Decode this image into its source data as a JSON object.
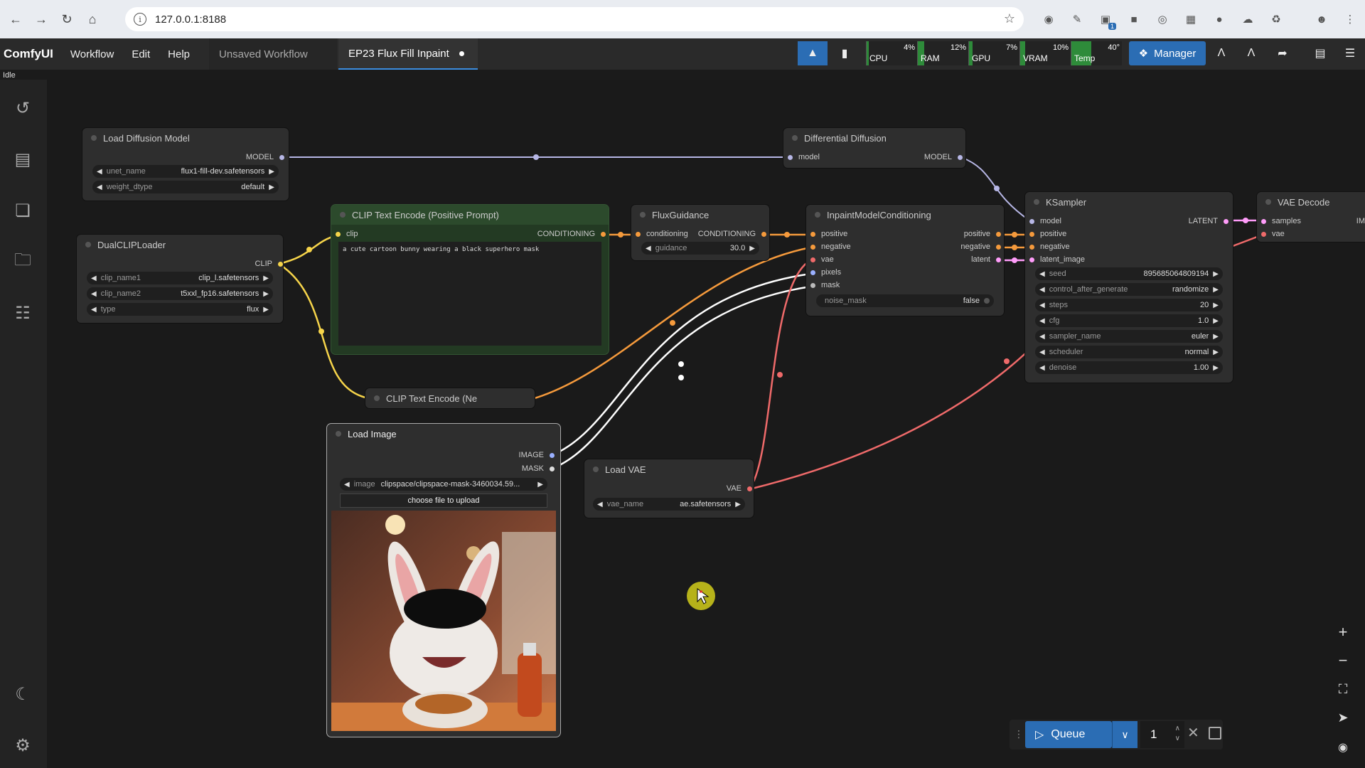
{
  "browser": {
    "url": "127.0.0.1:8188",
    "ext_badge": "1"
  },
  "topbar": {
    "brand": "ComfyUI",
    "menu": [
      "Workflow",
      "Edit",
      "Help"
    ],
    "tabs": [
      {
        "label": "Unsaved Workflow"
      },
      {
        "label": "EP23 Flux Fill Inpaint"
      }
    ],
    "status": "Idle",
    "monitors": [
      {
        "label": "CPU",
        "pct": "4%",
        "value": 4
      },
      {
        "label": "RAM",
        "pct": "12%",
        "value": 12
      },
      {
        "label": "GPU",
        "pct": "7%",
        "value": 7
      },
      {
        "label": "VRAM",
        "pct": "10%",
        "value": 10
      },
      {
        "label": "Temp",
        "pct": "40°",
        "value": 40
      }
    ],
    "manager_label": "Manager"
  },
  "nodes": {
    "load_diffusion": {
      "title": "Load Diffusion Model",
      "out_model": "MODEL",
      "unet_name_label": "unet_name",
      "unet_name_value": "flux1-fill-dev.safetensors",
      "weight_dtype_label": "weight_dtype",
      "weight_dtype_value": "default"
    },
    "dual_clip": {
      "title": "DualCLIPLoader",
      "out_clip": "CLIP",
      "clip_name1_label": "clip_name1",
      "clip_name1_value": "clip_l.safetensors",
      "clip_name2_label": "clip_name2",
      "clip_name2_value": "t5xxl_fp16.safetensors",
      "type_label": "type",
      "type_value": "flux"
    },
    "clip_pos": {
      "title": "CLIP Text Encode (Positive Prompt)",
      "in_clip": "clip",
      "out_cond": "CONDITIONING",
      "text": "a cute cartoon bunny wearing a black superhero mask"
    },
    "clip_neg": {
      "title": "CLIP Text Encode (Ne"
    },
    "flux_guidance": {
      "title": "FluxGuidance",
      "in_cond": "conditioning",
      "out_cond": "CONDITIONING",
      "guidance_label": "guidance",
      "guidance_value": "30.0"
    },
    "diff_diffusion": {
      "title": "Differential Diffusion",
      "in_model": "model",
      "out_model": "MODEL"
    },
    "inpaint_cond": {
      "title": "InpaintModelConditioning",
      "in_positive": "positive",
      "in_negative": "negative",
      "in_vae": "vae",
      "in_pixels": "pixels",
      "in_mask": "mask",
      "out_positive": "positive",
      "out_negative": "negative",
      "out_latent": "latent",
      "noise_mask_label": "noise_mask",
      "noise_mask_value": "false"
    },
    "ksampler": {
      "title": "KSampler",
      "in_model": "model",
      "in_positive": "positive",
      "in_negative": "negative",
      "in_latent": "latent_image",
      "out_latent": "LATENT",
      "widgets": [
        {
          "label": "seed",
          "value": "895685064809194"
        },
        {
          "label": "control_after_generate",
          "value": "randomize"
        },
        {
          "label": "steps",
          "value": "20"
        },
        {
          "label": "cfg",
          "value": "1.0"
        },
        {
          "label": "sampler_name",
          "value": "euler"
        },
        {
          "label": "scheduler",
          "value": "normal"
        },
        {
          "label": "denoise",
          "value": "1.00"
        }
      ]
    },
    "vae_decode": {
      "title": "VAE Decode",
      "in_samples": "samples",
      "in_vae": "vae",
      "out_image": "IM"
    },
    "load_image": {
      "title": "Load Image",
      "out_image": "IMAGE",
      "out_mask": "MASK",
      "image_label": "image",
      "image_value": "clipspace/clipspace-mask-3460034.59...",
      "upload_label": "choose file to upload"
    },
    "load_vae": {
      "title": "Load VAE",
      "out_vae": "VAE",
      "vae_name_label": "vae_name",
      "vae_name_value": "ae.safetensors"
    }
  },
  "queue": {
    "label": "Queue",
    "count": "1"
  },
  "colors": {
    "accent": "#2b6db4",
    "model_link": "#b7b7e6",
    "clip_link": "#f6d44a",
    "cond_link": "#f59a3c",
    "vae_link": "#ef6a6a",
    "image_link": "#ffffff",
    "latent_link": "#ff9cf9"
  }
}
